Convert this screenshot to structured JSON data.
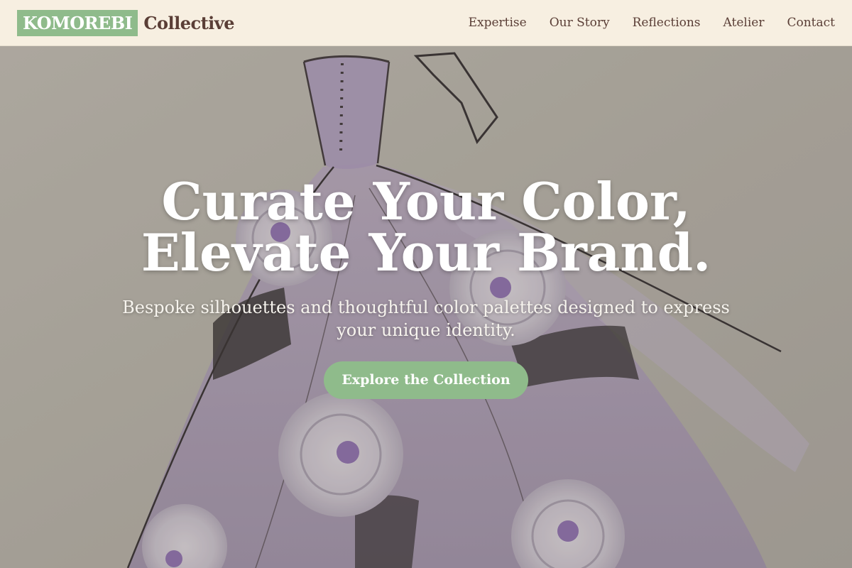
{
  "header": {
    "brand_mark": "KOMOREBI",
    "brand_word": "Collective",
    "nav": [
      {
        "label": "Expertise"
      },
      {
        "label": "Our Story"
      },
      {
        "label": "Reflections"
      },
      {
        "label": "Atelier"
      },
      {
        "label": "Contact"
      }
    ]
  },
  "hero": {
    "title_line1": "Curate Your Color,",
    "title_line2": "Elevate Your Brand.",
    "subtitle": "Bespoke silhouettes and thoughtful color palettes designed to express your unique identity.",
    "cta_label": "Explore the Collection",
    "image_subject": "watercolor-gown-sketch"
  },
  "colors": {
    "header_bg": "#f7efe1",
    "brand_green": "#8fbb8b",
    "brand_brown": "#5a3e36",
    "lavender": "#a797b8"
  }
}
